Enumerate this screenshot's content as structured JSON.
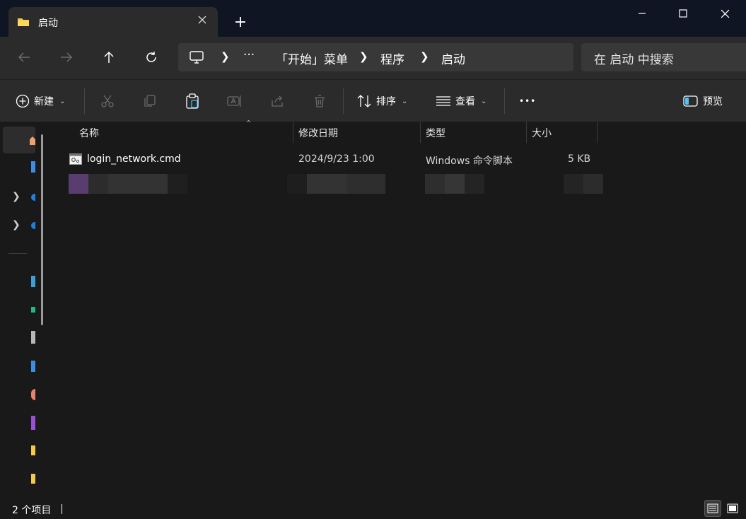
{
  "window": {
    "tab_title": "启动",
    "new_tab_symbol": "+"
  },
  "address": {
    "overflow": "···",
    "crumbs": [
      "「开始」菜单",
      "程序",
      "启动"
    ],
    "search_placeholder": "在 启动 中搜索"
  },
  "commands": {
    "new_label": "新建",
    "sort_label": "排序",
    "view_label": "查看",
    "more_label": "•••",
    "preview_label": "预览"
  },
  "columns": {
    "name": "名称",
    "modified": "修改日期",
    "type": "类型",
    "size": "大小"
  },
  "files": [
    {
      "name": "login_network.cmd",
      "modified": "2024/9/23 1:00",
      "type": "Windows 命令脚本",
      "size": "5 KB"
    }
  ],
  "status": {
    "item_count": "2 个项目"
  },
  "colors": {
    "accent": "#4cc2ff",
    "folder": "#f7c948",
    "background": "#191919",
    "toolbar": "#2b2b2b"
  }
}
